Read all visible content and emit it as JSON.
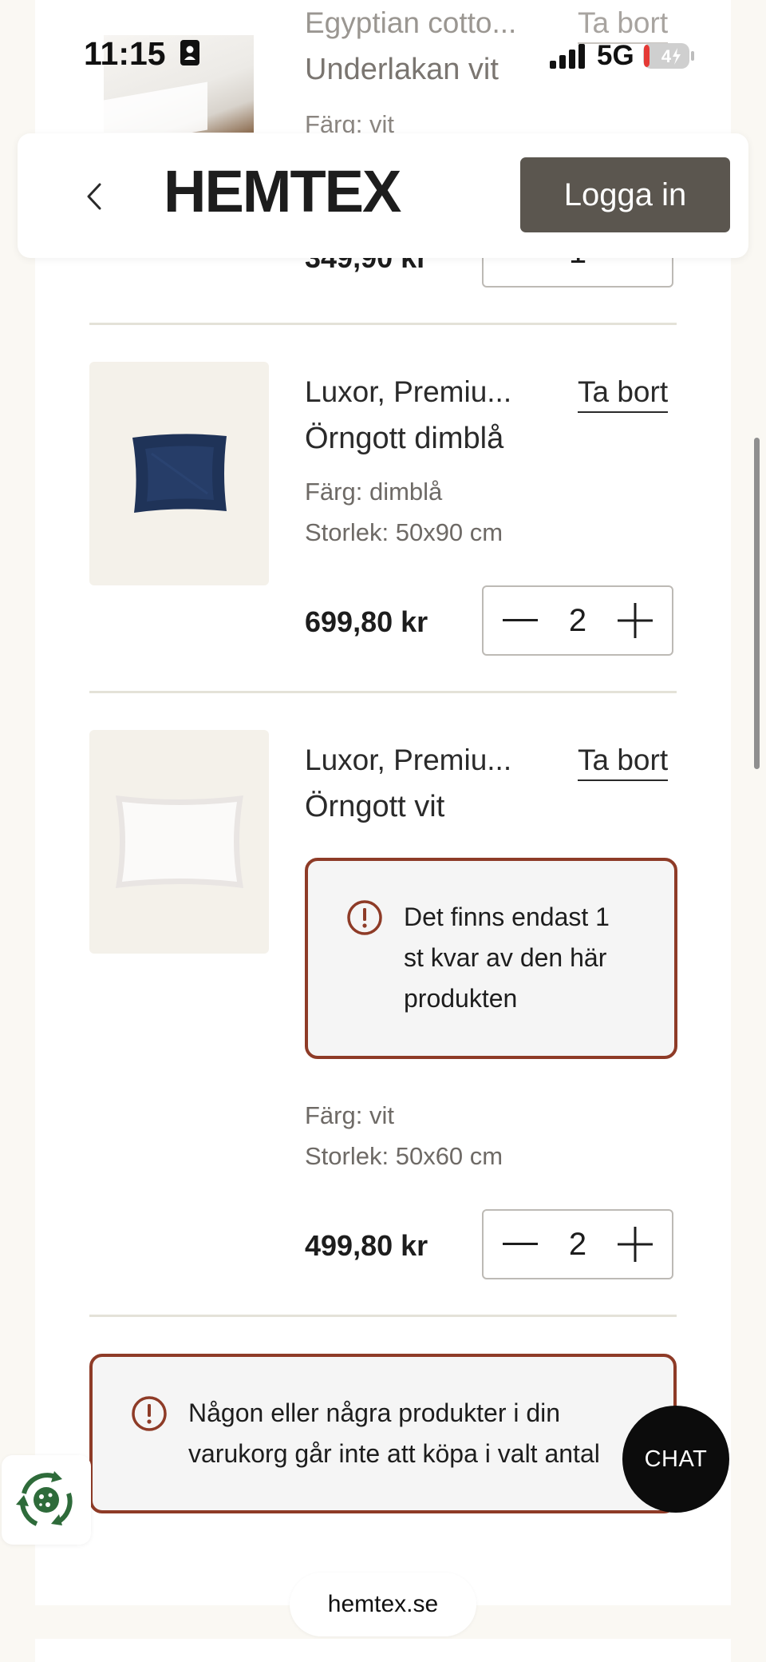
{
  "status_bar": {
    "time": "11:15",
    "network": "5G",
    "battery": "4"
  },
  "header": {
    "logo": "HEMTEX",
    "login_label": "Logga in"
  },
  "cart": {
    "items": [
      {
        "brand": "Egyptian cotto...",
        "name": "Underlakan vit",
        "color": "Färg: vit",
        "price": "349,90 kr",
        "quantity": "1",
        "remove_label": "Ta bort"
      },
      {
        "brand": "Luxor, Premiu...",
        "name": "Örngott dimblå",
        "color": "Färg: dimblå",
        "size": "Storlek: 50x90 cm",
        "price": "699,80 kr",
        "quantity": "2",
        "remove_label": "Ta bort"
      },
      {
        "brand": "Luxor, Premiu...",
        "name": "Örngott vit",
        "stock_warning": [
          "Det finns endast 1",
          "st kvar av den här",
          "produkten"
        ],
        "color": "Färg: vit",
        "size": "Storlek: 50x60 cm",
        "price": "499,80 kr",
        "quantity": "2",
        "remove_label": "Ta bort"
      }
    ],
    "cart_warning": [
      "Någon eller några produkter i din",
      "varukorg går inte att köpa i valt antal"
    ]
  },
  "chat": {
    "label": "CHAT"
  },
  "browser": {
    "url": "hemtex.se"
  },
  "colors": {
    "warning_border": "#8e3b27",
    "login_bg": "#5b564f",
    "thumb_bg": "#f4f1ea",
    "navy_pillow": "#1f3358"
  }
}
